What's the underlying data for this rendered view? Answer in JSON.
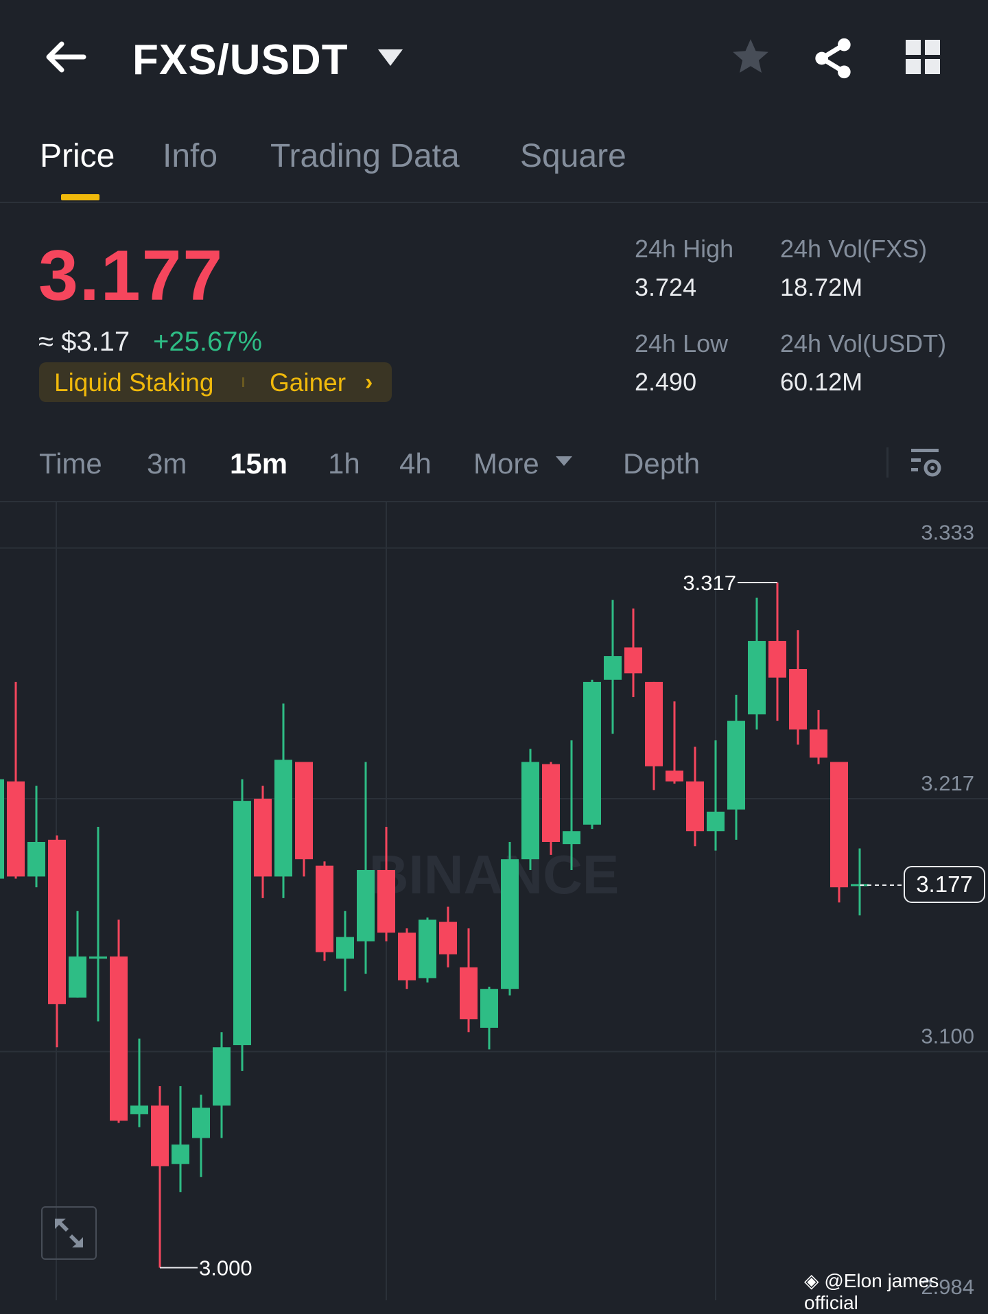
{
  "header": {
    "back_icon": "arrow-left-icon",
    "pair": "FXS/USDT",
    "favorite_icon": "star-icon",
    "share_icon": "share-icon",
    "menu_icon": "grid-icon"
  },
  "tabs": [
    {
      "label": "Price",
      "active": true
    },
    {
      "label": "Info"
    },
    {
      "label": "Trading Data"
    },
    {
      "label": "Square"
    }
  ],
  "ticker": {
    "last_price": "3.177",
    "fiat_price": "≈ $3.17",
    "change_pct": "+25.67%",
    "tags": [
      "Liquid Staking",
      "Gainer"
    ],
    "stats": {
      "high_label": "24h High",
      "high": "3.724",
      "low_label": "24h Low",
      "low": "2.490",
      "vol_base_label": "24h Vol(FXS)",
      "vol_base": "18.72M",
      "vol_quote_label": "24h Vol(USDT)",
      "vol_quote": "60.12M"
    }
  },
  "timeframes": {
    "items": [
      "Time",
      "3m",
      "15m",
      "1h",
      "4h",
      "More",
      "Depth"
    ],
    "active": "15m"
  },
  "colors": {
    "up": "#2ebd85",
    "down": "#f6465d",
    "accent": "#f0b90b"
  },
  "chart_data": {
    "type": "candlestick",
    "interval": "15m",
    "y_ticks": [
      "3.333",
      "3.217",
      "3.100",
      "2.984"
    ],
    "ylim": [
      2.984,
      3.333
    ],
    "max_label": "3.317",
    "min_label": "3.000",
    "current_price_label": "3.177",
    "watermark": "BINANCE",
    "candles": [
      [
        3.18,
        3.226,
        3.18,
        3.226
      ],
      [
        3.225,
        3.271,
        3.18,
        3.181
      ],
      [
        3.181,
        3.223,
        3.176,
        3.197
      ],
      [
        3.198,
        3.2,
        3.102,
        3.122
      ],
      [
        3.125,
        3.165,
        3.125,
        3.144
      ],
      [
        3.143,
        3.204,
        3.114,
        3.144
      ],
      [
        3.144,
        3.161,
        3.067,
        3.068
      ],
      [
        3.071,
        3.106,
        3.065,
        3.075
      ],
      [
        3.075,
        3.084,
        3.0,
        3.047
      ],
      [
        3.048,
        3.084,
        3.035,
        3.057
      ],
      [
        3.06,
        3.08,
        3.042,
        3.074
      ],
      [
        3.075,
        3.109,
        3.06,
        3.102
      ],
      [
        3.103,
        3.226,
        3.091,
        3.216
      ],
      [
        3.217,
        3.223,
        3.171,
        3.181
      ],
      [
        3.181,
        3.261,
        3.171,
        3.235
      ],
      [
        3.234,
        3.234,
        3.181,
        3.189
      ],
      [
        3.186,
        3.188,
        3.142,
        3.146
      ],
      [
        3.143,
        3.165,
        3.128,
        3.153
      ],
      [
        3.151,
        3.234,
        3.136,
        3.184
      ],
      [
        3.184,
        3.204,
        3.151,
        3.155
      ],
      [
        3.155,
        3.157,
        3.129,
        3.133
      ],
      [
        3.134,
        3.162,
        3.132,
        3.161
      ],
      [
        3.16,
        3.167,
        3.139,
        3.145
      ],
      [
        3.139,
        3.157,
        3.109,
        3.115
      ],
      [
        3.111,
        3.13,
        3.101,
        3.129
      ],
      [
        3.129,
        3.197,
        3.126,
        3.189
      ],
      [
        3.189,
        3.24,
        3.184,
        3.234
      ],
      [
        3.233,
        3.234,
        3.191,
        3.197
      ],
      [
        3.196,
        3.244,
        3.184,
        3.202
      ],
      [
        3.205,
        3.272,
        3.203,
        3.271
      ],
      [
        3.272,
        3.309,
        3.247,
        3.283
      ],
      [
        3.287,
        3.305,
        3.264,
        3.275
      ],
      [
        3.271,
        3.271,
        3.221,
        3.232
      ],
      [
        3.23,
        3.262,
        3.224,
        3.225
      ],
      [
        3.225,
        3.241,
        3.195,
        3.202
      ],
      [
        3.202,
        3.244,
        3.193,
        3.211
      ],
      [
        3.212,
        3.265,
        3.198,
        3.253
      ],
      [
        3.256,
        3.31,
        3.249,
        3.29
      ],
      [
        3.29,
        3.317,
        3.253,
        3.273
      ],
      [
        3.277,
        3.295,
        3.242,
        3.249
      ],
      [
        3.249,
        3.258,
        3.233,
        3.236
      ],
      [
        3.234,
        3.234,
        3.169,
        3.176
      ],
      [
        3.177,
        3.194,
        3.163,
        3.1775
      ]
    ],
    "candle_fields": [
      "open",
      "high",
      "low",
      "close"
    ]
  },
  "watermark": "@Elon james official"
}
